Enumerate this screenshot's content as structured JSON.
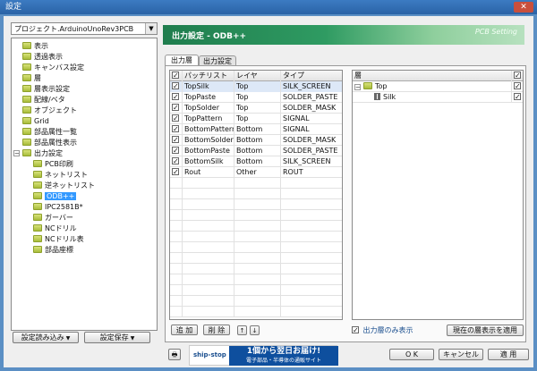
{
  "window": {
    "title": "設定",
    "close_glyph": "✕"
  },
  "project": {
    "selected": "プロジェクト.ArduinoUnoRev3PCB",
    "arrow": "▼"
  },
  "tree": {
    "items": [
      {
        "label": "表示"
      },
      {
        "label": "透過表示"
      },
      {
        "label": "キャンバス設定"
      },
      {
        "label": "層"
      },
      {
        "label": "層表示設定"
      },
      {
        "label": "配線/ベタ"
      },
      {
        "label": "オブジェクト"
      },
      {
        "label": "Grid"
      },
      {
        "label": "部品属性一覧"
      },
      {
        "label": "部品属性表示"
      },
      {
        "label": "出力設定",
        "expander": "−"
      },
      {
        "label": "PCB印刷"
      },
      {
        "label": "ネットリスト"
      },
      {
        "label": "逆ネットリスト"
      },
      {
        "label": "ODB++"
      },
      {
        "label": "IPC2581B*"
      },
      {
        "label": "ガーバー"
      },
      {
        "label": "NCドリル"
      },
      {
        "label": "NCドリル表"
      },
      {
        "label": "部品座標"
      }
    ]
  },
  "left_buttons": {
    "load": "設定読み込み",
    "save": "設定保存",
    "dd": "▼"
  },
  "header": {
    "title": "出力設定 - ODB++",
    "right": "PCB Setting"
  },
  "tabs": [
    {
      "label": "出力層"
    },
    {
      "label": "出力設定"
    }
  ],
  "layer_table": {
    "check_glyph": "✓",
    "headers": {
      "name": "パッチリスト",
      "layer": "レイヤ",
      "type": "タイプ"
    },
    "rows": [
      {
        "name": "TopSilk",
        "layer": "Top",
        "type": "SILK_SCREEN",
        "checked": "✓"
      },
      {
        "name": "TopPaste",
        "layer": "Top",
        "type": "SOLDER_PASTE",
        "checked": "✓"
      },
      {
        "name": "TopSolder",
        "layer": "Top",
        "type": "SOLDER_MASK",
        "checked": "✓"
      },
      {
        "name": "TopPattern",
        "layer": "Top",
        "type": "SIGNAL",
        "checked": "✓"
      },
      {
        "name": "BottomPattern",
        "layer": "Bottom",
        "type": "SIGNAL",
        "checked": "✓"
      },
      {
        "name": "BottomSolder",
        "layer": "Bottom",
        "type": "SOLDER_MASK",
        "checked": "✓"
      },
      {
        "name": "BottomPaste",
        "layer": "Bottom",
        "type": "SOLDER_PASTE",
        "checked": "✓"
      },
      {
        "name": "BottomSilk",
        "layer": "Bottom",
        "type": "SILK_SCREEN",
        "checked": "✓"
      },
      {
        "name": "Rout",
        "layer": "Other",
        "type": "ROUT",
        "checked": "✓"
      }
    ]
  },
  "layer_buttons": {
    "add": "追 加",
    "delete": "削 除",
    "up": "↑",
    "down": "↓"
  },
  "output_tree": {
    "header": "層",
    "check_glyph": "✓",
    "rows": [
      {
        "label": "Top",
        "expander": "−",
        "checked": "✓"
      },
      {
        "label": "Silk",
        "checked": "✓"
      }
    ]
  },
  "show_output_only": {
    "label": "出力層のみ表示",
    "checked": "✓"
  },
  "apply_current": "現在の層表示を適用",
  "banner": {
    "logo": "ship-stop",
    "line1": "1個から翌日お届け!",
    "line2": "電子部品・半導体の通販サイト"
  },
  "footer": {
    "ok": "O K",
    "cancel": "キャンセル",
    "apply": "適 用"
  },
  "print_glyph": "🖶"
}
